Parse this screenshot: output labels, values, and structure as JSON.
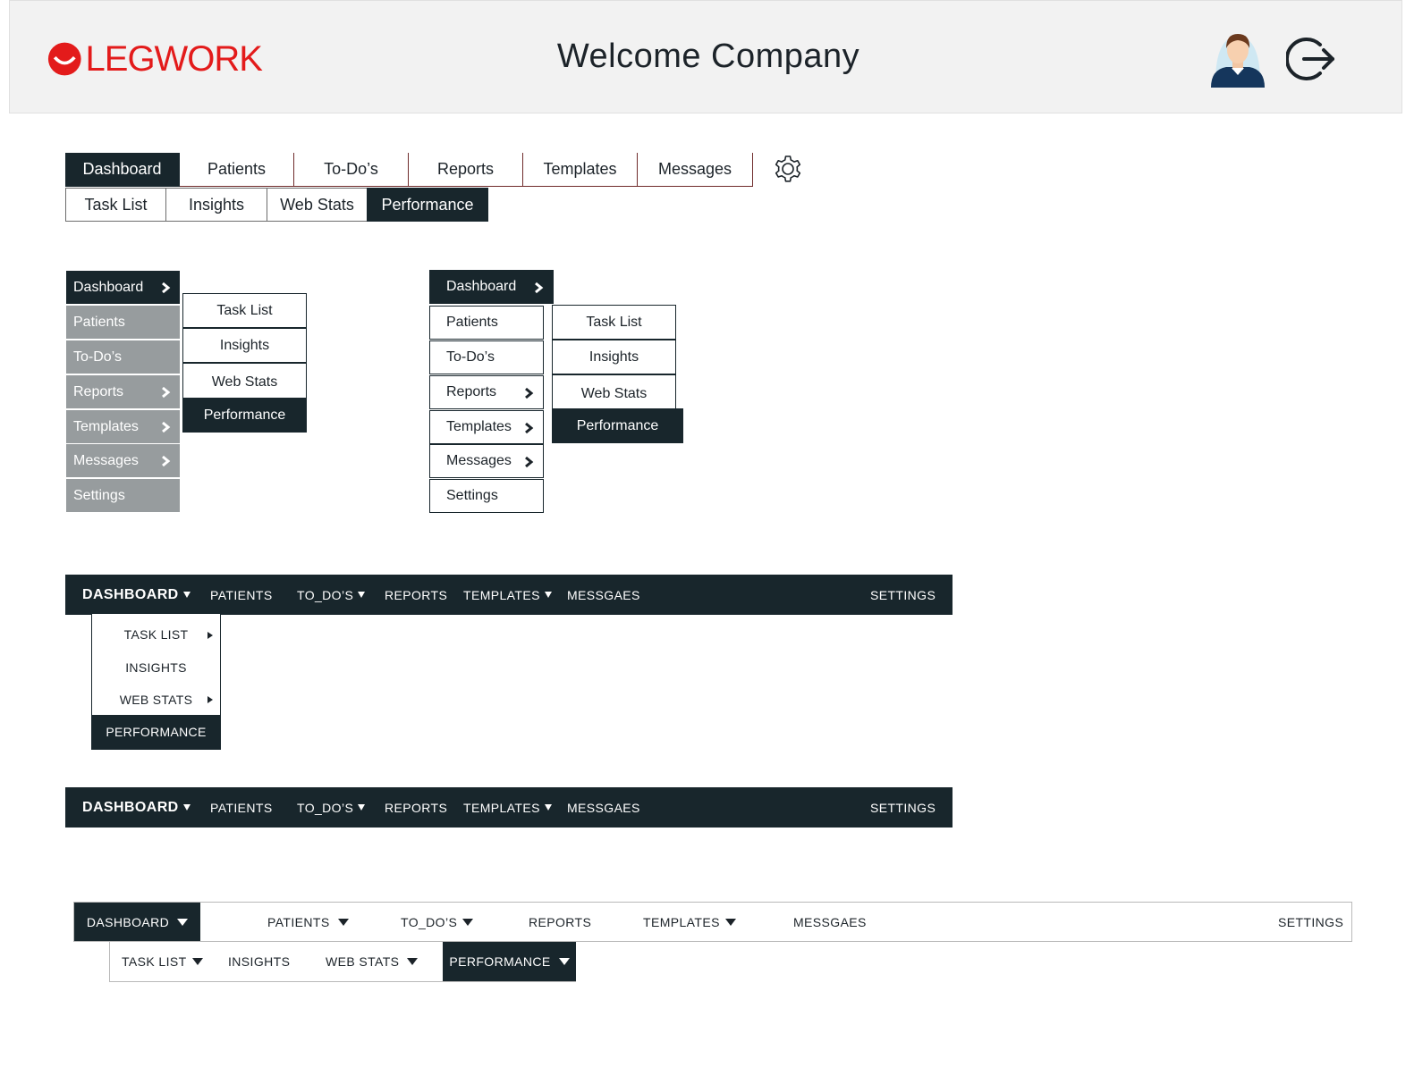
{
  "header": {
    "logo_text": "LEGWORK",
    "welcome": "Welcome Company",
    "brand_color": "#e31b1b",
    "dark_color": "#18262c"
  },
  "tabs_v1": {
    "main": [
      "Dashboard",
      "Patients",
      "To-Do’s",
      "Reports",
      "Templates",
      "Messages"
    ],
    "active_main": "Dashboard",
    "sub": [
      "Task List",
      "Insights",
      "Web Stats",
      "Performance"
    ],
    "active_sub": "Performance",
    "settings_icon": "gear-icon"
  },
  "vmenu_gray": {
    "items": [
      "Dashboard",
      "Patients",
      "To-Do’s",
      "Reports",
      "Templates",
      "Messages",
      "Settings"
    ],
    "popup": [
      "Task List",
      "Insights",
      "Web Stats",
      "Performance"
    ]
  },
  "vmenu_white": {
    "items": [
      "Dashboard",
      "Patients",
      "To-Do’s",
      "Reports",
      "Templates",
      "Messages",
      "Settings"
    ],
    "popup": [
      "Task List",
      "Insights",
      "Web Stats",
      "Performance"
    ]
  },
  "navbar": {
    "items": [
      "DASHBOARD",
      "PATIENTS",
      "TO_DO’S",
      "REPORTS",
      "TEMPLATES",
      "MESSGAES"
    ],
    "settings": "SETTINGS",
    "dropdown": [
      "TASK LIST",
      "INSIGHTS",
      "WEB STATS",
      "PERFORMANCE"
    ]
  },
  "lightbar": {
    "items": [
      "DASHBOARD",
      "PATIENTS",
      "TO_DO’S",
      "REPORTS",
      "TEMPLATES",
      "MESSGAES"
    ],
    "settings": "SETTINGS",
    "sub": [
      "TASK LIST",
      "INSIGHTS",
      "WEB STATS",
      "PERFORMANCE"
    ]
  }
}
